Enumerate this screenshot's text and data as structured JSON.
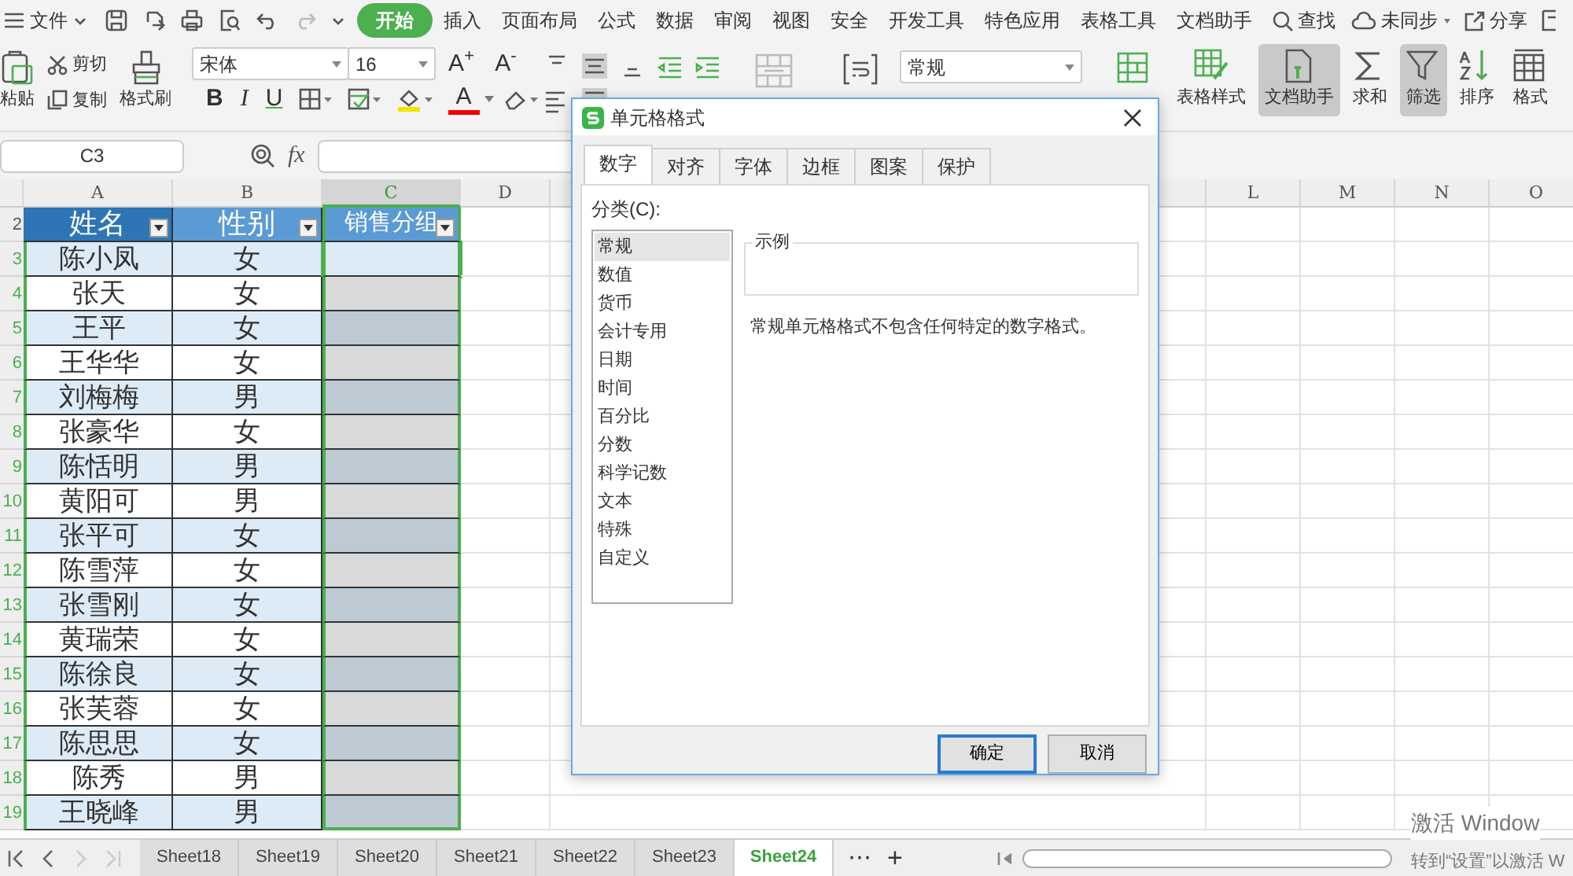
{
  "menu": {
    "file": "文件",
    "tabs": [
      {
        "label": "开始",
        "selected": true
      },
      {
        "label": "插入",
        "selected": false
      },
      {
        "label": "页面布局",
        "selected": false
      },
      {
        "label": "公式",
        "selected": false
      },
      {
        "label": "数据",
        "selected": false
      },
      {
        "label": "审阅",
        "selected": false
      },
      {
        "label": "视图",
        "selected": false
      },
      {
        "label": "安全",
        "selected": false
      },
      {
        "label": "开发工具",
        "selected": false
      },
      {
        "label": "特色应用",
        "selected": false
      },
      {
        "label": "表格工具",
        "selected": false
      },
      {
        "label": "文档助手",
        "selected": false
      }
    ],
    "search": "查找",
    "sync": "未同步",
    "share": "分享"
  },
  "ribbon": {
    "paste": "粘贴",
    "cut": "剪切",
    "copy": "复制",
    "format_painter": "格式刷",
    "font_name": "宋体",
    "font_size": "16",
    "grow": "A$^{+}$",
    "shrink": "A$^{-}$",
    "styles": [
      "B",
      "I",
      "U"
    ],
    "font_color": "A",
    "number_format": "常规",
    "tools": [
      {
        "kind": "table-style",
        "label": "表格样式",
        "highlighted": false
      },
      {
        "kind": "doc-helper",
        "label": "文档助手",
        "highlighted": true
      },
      {
        "kind": "sum",
        "label": "求和",
        "highlighted": false
      },
      {
        "kind": "filter",
        "label": "筛选",
        "highlighted": true
      },
      {
        "kind": "sort",
        "label": "排序",
        "highlighted": false
      },
      {
        "kind": "format",
        "label": "格式",
        "highlighted": false
      }
    ]
  },
  "formula_bar": {
    "cell": "C3",
    "fx": "fx"
  },
  "sheet": {
    "columns_left": [
      "A",
      "B",
      "C",
      "D"
    ],
    "columns_right": [
      "L",
      "M",
      "N",
      "O"
    ],
    "header_row": "2",
    "headers": [
      "姓名",
      "性别",
      "销售分组"
    ],
    "rows": [
      {
        "num": "3",
        "name": "陈小凤",
        "gender": "女",
        "active": true
      },
      {
        "num": "4",
        "name": "张天",
        "gender": "女",
        "active": false
      },
      {
        "num": "5",
        "name": "王平",
        "gender": "女",
        "active": false
      },
      {
        "num": "6",
        "name": "王华华",
        "gender": "女",
        "active": false
      },
      {
        "num": "7",
        "name": "刘梅梅",
        "gender": "男",
        "active": false
      },
      {
        "num": "8",
        "name": "张豪华",
        "gender": "女",
        "active": false
      },
      {
        "num": "9",
        "name": "陈恬明",
        "gender": "男",
        "active": false
      },
      {
        "num": "10",
        "name": "黄阳可",
        "gender": "男",
        "active": false
      },
      {
        "num": "11",
        "name": "张平可",
        "gender": "女",
        "active": false
      },
      {
        "num": "12",
        "name": "陈雪萍",
        "gender": "女",
        "active": false
      },
      {
        "num": "13",
        "name": "张雪刚",
        "gender": "女",
        "active": false
      },
      {
        "num": "14",
        "name": "黄瑞荣",
        "gender": "女",
        "active": false
      },
      {
        "num": "15",
        "name": "陈徐良",
        "gender": "女",
        "active": false
      },
      {
        "num": "16",
        "name": "张芙蓉",
        "gender": "女",
        "active": false
      },
      {
        "num": "17",
        "name": "陈思思",
        "gender": "女",
        "active": false
      },
      {
        "num": "18",
        "name": "陈秀",
        "gender": "男",
        "active": false
      },
      {
        "num": "19",
        "name": "王晓峰",
        "gender": "男",
        "active": false
      }
    ]
  },
  "dialog": {
    "title": "单元格格式",
    "tabs": [
      {
        "label": "数字",
        "selected": true
      },
      {
        "label": "对齐",
        "selected": false
      },
      {
        "label": "字体",
        "selected": false
      },
      {
        "label": "边框",
        "selected": false
      },
      {
        "label": "图案",
        "selected": false
      },
      {
        "label": "保护",
        "selected": false
      }
    ],
    "category_label": "分类(C):",
    "categories": [
      {
        "label": "常规",
        "selected": true
      },
      {
        "label": "数值",
        "selected": false
      },
      {
        "label": "货币",
        "selected": false
      },
      {
        "label": "会计专用",
        "selected": false
      },
      {
        "label": "日期",
        "selected": false
      },
      {
        "label": "时间",
        "selected": false
      },
      {
        "label": "百分比",
        "selected": false
      },
      {
        "label": "分数",
        "selected": false
      },
      {
        "label": "科学记数",
        "selected": false
      },
      {
        "label": "文本",
        "selected": false
      },
      {
        "label": "特殊",
        "selected": false
      },
      {
        "label": "自定义",
        "selected": false
      }
    ],
    "sample_label": "示例",
    "description": "常规单元格格式不包含任何特定的数字格式。",
    "ok": "确定",
    "cancel": "取消"
  },
  "sheet_tabs": [
    {
      "label": "Sheet18",
      "selected": false
    },
    {
      "label": "Sheet19",
      "selected": false
    },
    {
      "label": "Sheet20",
      "selected": false
    },
    {
      "label": "Sheet21",
      "selected": false
    },
    {
      "label": "Sheet22",
      "selected": false
    },
    {
      "label": "Sheet23",
      "selected": false
    },
    {
      "label": "Sheet24",
      "selected": true
    }
  ],
  "sheet_more": "⋯",
  "sheet_add": "+",
  "windows_notice": [
    "激活 Window",
    "转到“设置”以激活 W"
  ]
}
